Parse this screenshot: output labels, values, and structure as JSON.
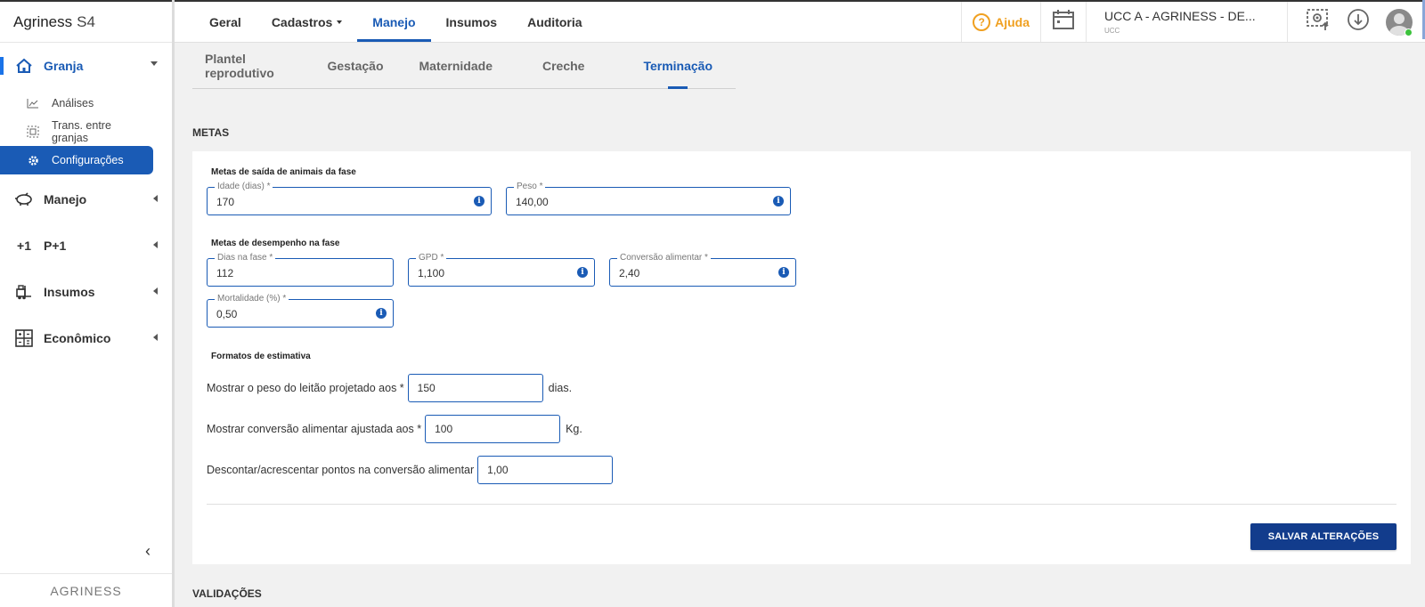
{
  "brand": {
    "name": "Agriness",
    "version": "S4"
  },
  "topnav": {
    "items": [
      {
        "label": "Geral"
      },
      {
        "label": "Cadastros"
      },
      {
        "label": "Manejo"
      },
      {
        "label": "Insumos"
      },
      {
        "label": "Auditoria"
      }
    ],
    "active": "Manejo"
  },
  "topbar": {
    "help_label": "Ajuda",
    "farm_name": "UCC A - AGRINESS - DE...",
    "farm_code": "UCC"
  },
  "sidebar": {
    "groups": [
      {
        "label": "Granja",
        "icon": "home-icon"
      },
      {
        "label": "Manejo",
        "icon": "pig-icon"
      },
      {
        "label": "P+1",
        "icon": "plus-one-icon"
      },
      {
        "label": "Insumos",
        "icon": "forklift-icon"
      },
      {
        "label": "Econômico",
        "icon": "calculator-icon"
      }
    ],
    "sub_items": [
      {
        "label": "Análises",
        "icon": "chart-icon"
      },
      {
        "label": "Trans. entre granjas",
        "icon": "transfer-icon"
      },
      {
        "label": "Configurações",
        "icon": "gear-icon"
      }
    ],
    "collapse_glyph": "‹",
    "footer_logo": "AGRINESS"
  },
  "subtabs": {
    "items": [
      {
        "label": "Plantel reprodutivo"
      },
      {
        "label": "Gestação"
      },
      {
        "label": "Maternidade"
      },
      {
        "label": "Creche"
      },
      {
        "label": "Terminação"
      }
    ],
    "active": "Terminação"
  },
  "metas": {
    "section_title": "METAS",
    "saida_title": "Metas de saída de animais da fase",
    "idade_label": "Idade (dias) *",
    "idade_value": "170",
    "peso_label": "Peso *",
    "peso_value": "140,00",
    "desempenho_title": "Metas de desempenho na fase",
    "dias_label": "Dias na fase *",
    "dias_value": "112",
    "gpd_label": "GPD *",
    "gpd_value": "1,100",
    "conversao_label": "Conversão alimentar *",
    "conversao_value": "2,40",
    "mortalidade_label": "Mortalidade (%) *",
    "mortalidade_value": "0,50",
    "formatos_title": "Formatos de estimativa",
    "peso_leitao_label": "Mostrar o peso do leitão projetado aos *",
    "peso_leitao_value": "150",
    "peso_leitao_unit": "dias.",
    "conv_ajustada_label": "Mostrar conversão alimentar ajustada aos *",
    "conv_ajustada_value": "100",
    "conv_ajustada_unit": "Kg.",
    "descontar_label": "Descontar/acrescentar pontos na conversão alimentar",
    "descontar_value": "1,00",
    "save_label": "SALVAR ALTERAÇÕES"
  },
  "validacoes": {
    "section_title": "VALIDAÇÕES"
  },
  "colors": {
    "primary": "#1a5bb5",
    "button": "#123c8c",
    "help": "#f0a020",
    "online": "#3cc23c"
  }
}
